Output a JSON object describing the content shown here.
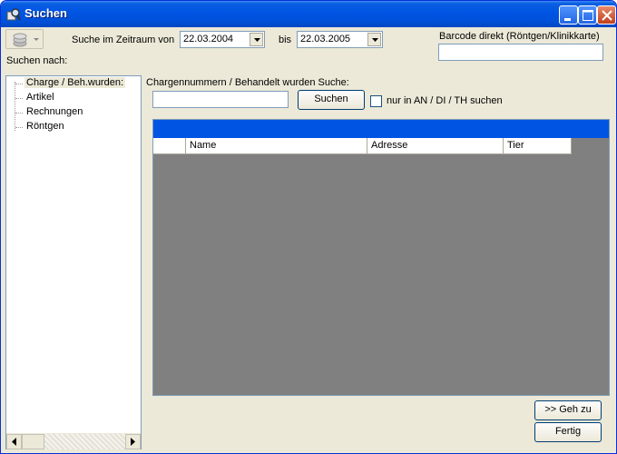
{
  "window": {
    "title": "Suchen"
  },
  "toolbar": {
    "dropdown_icon": "stack-icon"
  },
  "search": {
    "period_label": "Suche im Zeitraum von",
    "date_from": "22.03.2004",
    "until_label": "bis",
    "date_to": "22.03.2005",
    "barcode_label": "Barcode direkt (Röntgen/Klinikkarte)",
    "barcode_value": "",
    "search_by_label": "Suchen nach:"
  },
  "tree": {
    "items": [
      "Charge / Beh.wurden:",
      "Artikel",
      "Rechnungen",
      "Röntgen"
    ]
  },
  "charge": {
    "label": "Chargennummern / Behandelt wurden Suche:",
    "input_value": "",
    "search_button": "Suchen",
    "only_checkbox_label": "nur in AN / DI / TH suchen",
    "only_checked": false
  },
  "grid": {
    "columns": [
      "",
      "Name",
      "Adresse",
      "Tier"
    ]
  },
  "actions": {
    "goto_button": ">> Geh zu",
    "done_button": "Fertig"
  }
}
